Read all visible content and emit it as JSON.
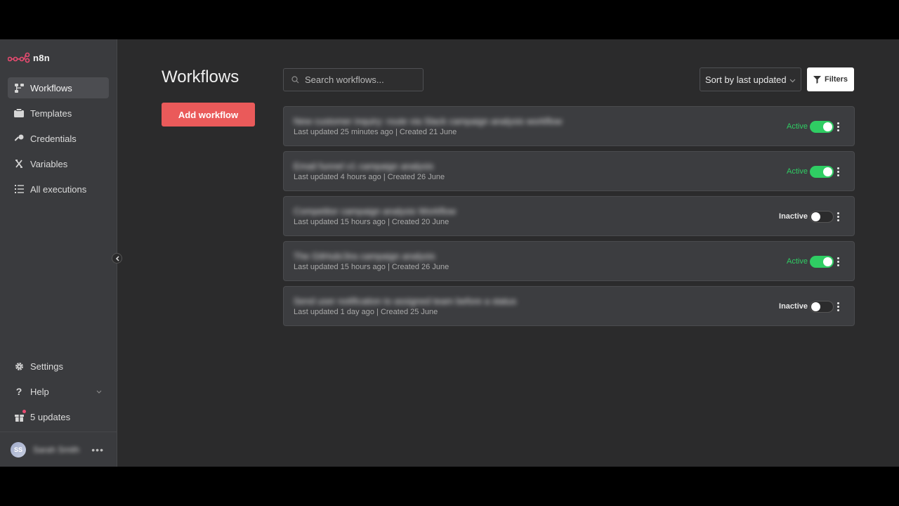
{
  "brand": {
    "name": "n8n",
    "accent": "#ea4b71"
  },
  "sidebar": {
    "items": [
      {
        "label": "Workflows",
        "icon": "workflow-icon",
        "active": true
      },
      {
        "label": "Templates",
        "icon": "templates-icon",
        "active": false
      },
      {
        "label": "Credentials",
        "icon": "key-icon",
        "active": false
      },
      {
        "label": "Variables",
        "icon": "variable-icon",
        "active": false
      },
      {
        "label": "All executions",
        "icon": "list-icon",
        "active": false
      }
    ],
    "bottom": {
      "settings": "Settings",
      "help": "Help",
      "updates": "5 updates"
    },
    "user": {
      "initials": "SS",
      "name": "Sarah Smith"
    }
  },
  "main": {
    "title": "Workflows",
    "add_button": "Add workflow",
    "search_placeholder": "Search workflows...",
    "sort_label": "Sort by last updated",
    "filters_label": "Filters"
  },
  "workflows": [
    {
      "name": "New customer inquiry: route via Slack campaign analysis workflow",
      "meta": "Last updated 25 minutes ago | Created 21 June",
      "status": "Active",
      "active": true
    },
    {
      "name": "Email funnel v1 campaign analysis",
      "meta": "Last updated 4 hours ago | Created 26 June",
      "status": "Active",
      "active": true
    },
    {
      "name": "Competitor campaign analysis Workflow",
      "meta": "Last updated 15 hours ago | Created 20 June",
      "status": "Inactive",
      "active": false
    },
    {
      "name": "The GitHub/Jira campaign analysis",
      "meta": "Last updated 15 hours ago | Created 26 June",
      "status": "Active",
      "active": true
    },
    {
      "name": "Send user notification to assigned team before a status",
      "meta": "Last updated 1 day ago | Created 25 June",
      "status": "Inactive",
      "active": false
    }
  ]
}
